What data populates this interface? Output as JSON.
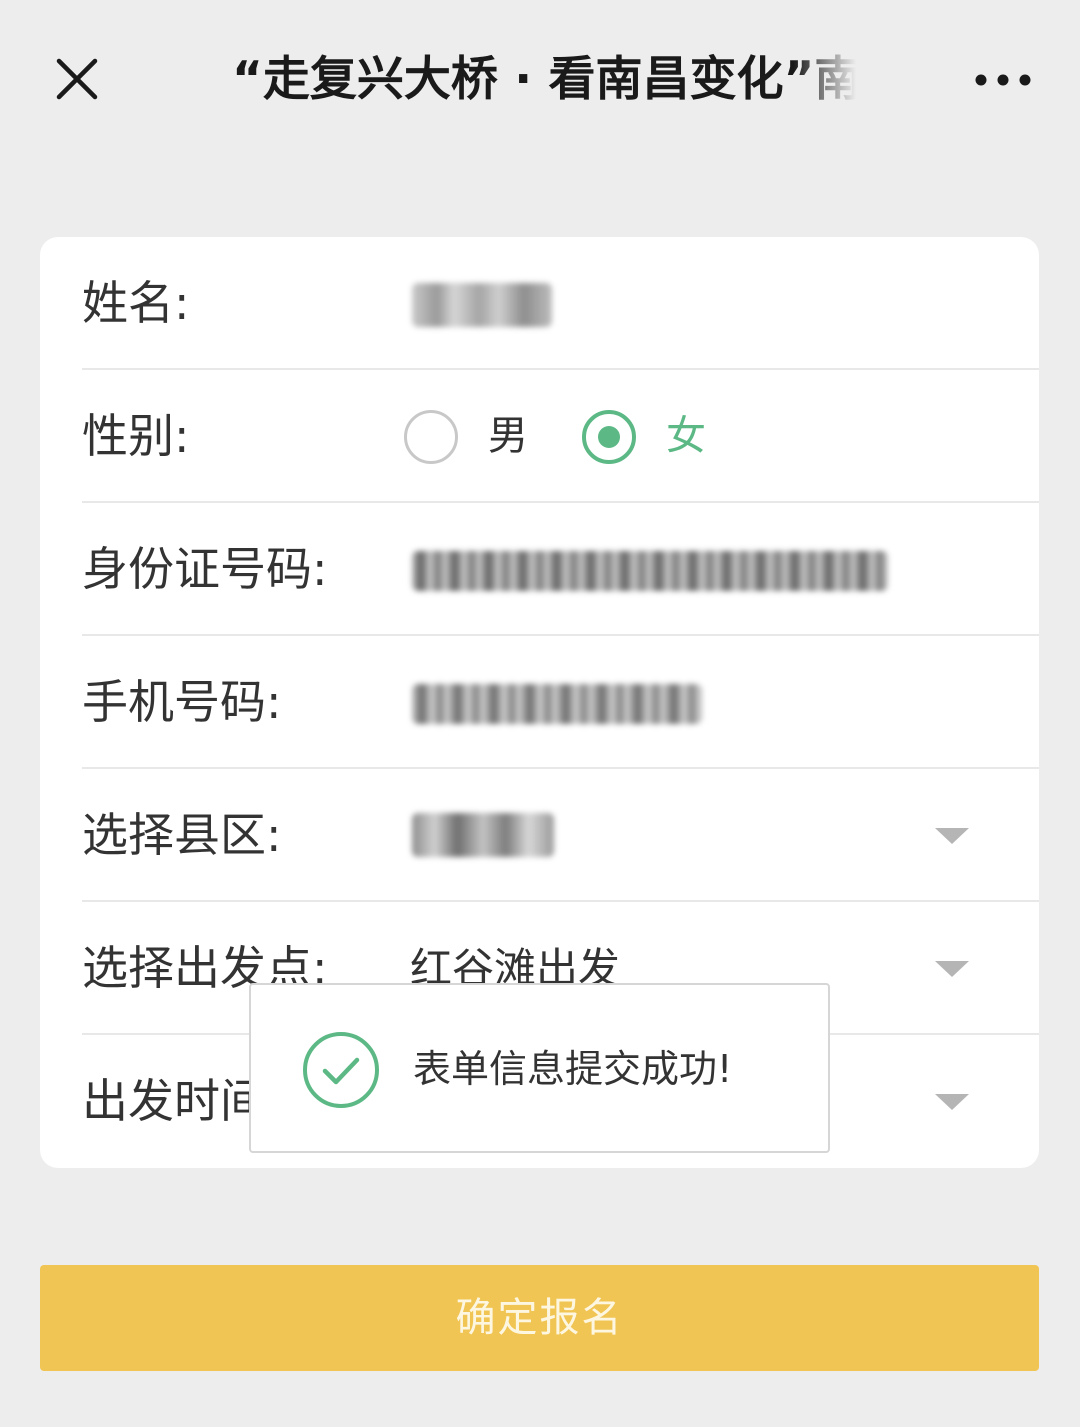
{
  "nav": {
    "title": "“走复兴大桥 · 看南昌变化”南昌",
    "close_icon": "close-icon",
    "more_icon": "more-icon"
  },
  "form": {
    "name": {
      "label": "姓名:",
      "value_redacted": true
    },
    "gender": {
      "label": "性别:",
      "options": [
        {
          "label": "男",
          "selected": false
        },
        {
          "label": "女",
          "selected": true
        }
      ]
    },
    "id_number": {
      "label": "身份证号码:",
      "value_redacted": true
    },
    "phone": {
      "label": "手机号码:",
      "value_redacted": true
    },
    "district": {
      "label": "选择县区:",
      "value_redacted": true
    },
    "departure_point": {
      "label": "选择出发点:",
      "value": "红谷滩出发"
    },
    "departure_time": {
      "label": "出发时间:"
    }
  },
  "toast": {
    "message": "表单信息提交成功!",
    "icon": "check-circle-icon"
  },
  "submit": {
    "label": "确定报名"
  },
  "colors": {
    "accent_green": "#5cb985",
    "button_yellow": "#f1c553",
    "background": "#ededed"
  }
}
